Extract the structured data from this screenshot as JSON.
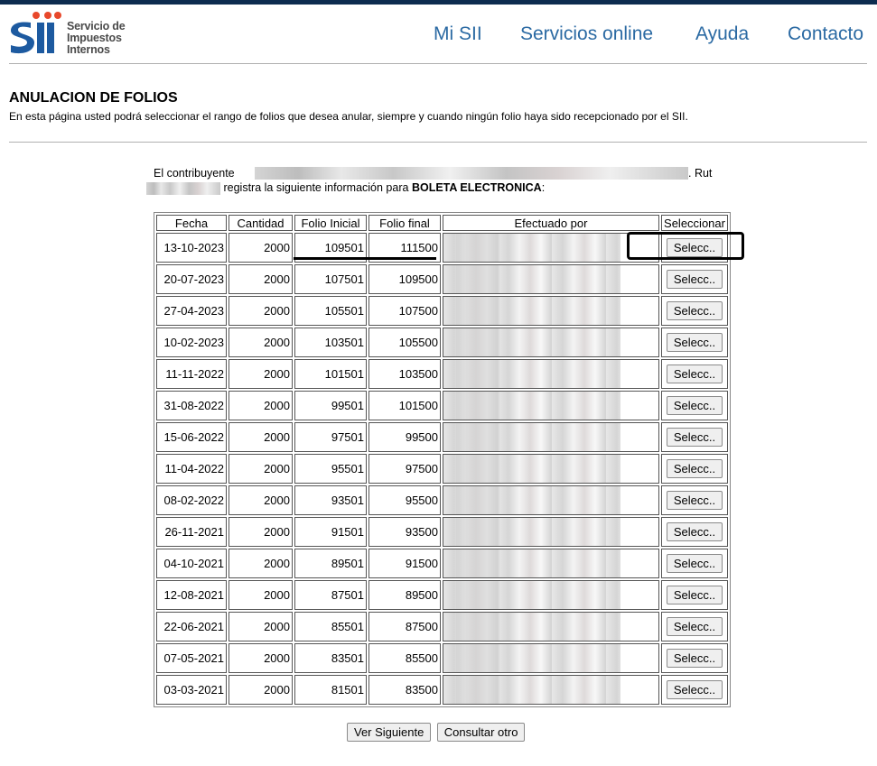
{
  "header": {
    "logo_lines": [
      "Servicio de",
      "Impuestos",
      "Internos"
    ],
    "brand": "SII",
    "nav": [
      {
        "label": "Mi SII"
      },
      {
        "label": "Servicios online"
      },
      {
        "label": "Ayuda"
      },
      {
        "label": "Contacto"
      }
    ]
  },
  "page": {
    "title": "ANULACION DE FOLIOS",
    "description": "En esta página usted podrá seleccionar el rango de folios que desea anular, siempre y cuando ningún folio haya sido recepcionado por el SII."
  },
  "contrib": {
    "prefix": "El  contribuyente",
    "suffix": ".  Rut",
    "middle": "registra la siguiente información para",
    "doc_type": "BOLETA ELECTRONICA",
    "end": ":"
  },
  "table": {
    "headers": [
      "Fecha",
      "Cantidad",
      "Folio Inicial",
      "Folio final",
      "Efectuado por",
      "Seleccionar"
    ],
    "button_label": "Selecc..",
    "rows": [
      {
        "fecha": "13-10-2023",
        "cantidad": "2000",
        "inicial": "109501",
        "final": "111500"
      },
      {
        "fecha": "20-07-2023",
        "cantidad": "2000",
        "inicial": "107501",
        "final": "109500"
      },
      {
        "fecha": "27-04-2023",
        "cantidad": "2000",
        "inicial": "105501",
        "final": "107500"
      },
      {
        "fecha": "10-02-2023",
        "cantidad": "2000",
        "inicial": "103501",
        "final": "105500"
      },
      {
        "fecha": "11-11-2022",
        "cantidad": "2000",
        "inicial": "101501",
        "final": "103500"
      },
      {
        "fecha": "31-08-2022",
        "cantidad": "2000",
        "inicial": "99501",
        "final": "101500"
      },
      {
        "fecha": "15-06-2022",
        "cantidad": "2000",
        "inicial": "97501",
        "final": "99500"
      },
      {
        "fecha": "11-04-2022",
        "cantidad": "2000",
        "inicial": "95501",
        "final": "97500"
      },
      {
        "fecha": "08-02-2022",
        "cantidad": "2000",
        "inicial": "93501",
        "final": "95500"
      },
      {
        "fecha": "26-11-2021",
        "cantidad": "2000",
        "inicial": "91501",
        "final": "93500"
      },
      {
        "fecha": "04-10-2021",
        "cantidad": "2000",
        "inicial": "89501",
        "final": "91500"
      },
      {
        "fecha": "12-08-2021",
        "cantidad": "2000",
        "inicial": "87501",
        "final": "89500"
      },
      {
        "fecha": "22-06-2021",
        "cantidad": "2000",
        "inicial": "85501",
        "final": "87500"
      },
      {
        "fecha": "07-05-2021",
        "cantidad": "2000",
        "inicial": "83501",
        "final": "85500"
      },
      {
        "fecha": "03-03-2021",
        "cantidad": "2000",
        "inicial": "81501",
        "final": "83500"
      }
    ]
  },
  "actions": {
    "next": "Ver Siguiente",
    "other": "Consultar otro"
  }
}
